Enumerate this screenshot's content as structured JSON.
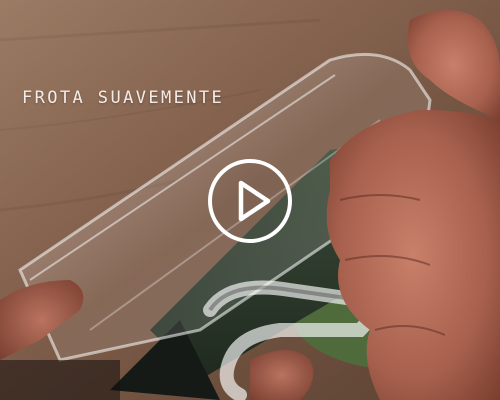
{
  "video": {
    "caption": "FROTA SUAVEMENTE",
    "controls": {
      "play_icon": "play-icon"
    }
  },
  "colors": {
    "caption_text": "#f3ece6",
    "play_button": "#ffffff",
    "background_wood": "#8a6a56",
    "background_dark": "#2a2320"
  }
}
